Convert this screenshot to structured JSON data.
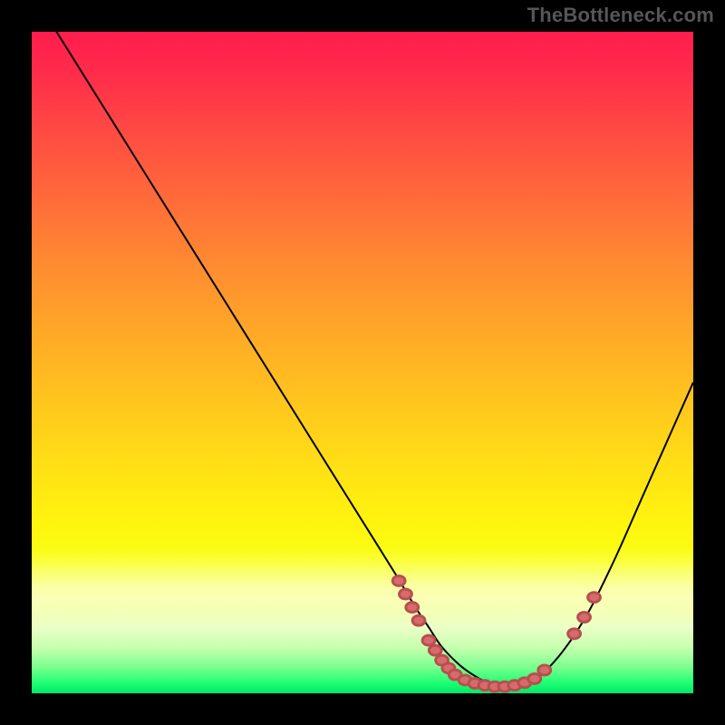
{
  "watermark": "TheBottleneck.com",
  "chart_data": {
    "type": "line",
    "title": "",
    "xlabel": "",
    "ylabel": "",
    "xlim": [
      0,
      100
    ],
    "ylim": [
      0,
      100
    ],
    "series": [
      {
        "name": "bottleneck-curve",
        "x": [
          0,
          5,
          10,
          15,
          20,
          25,
          30,
          35,
          40,
          45,
          50,
          55,
          58,
          60,
          62,
          65,
          68,
          70,
          73,
          76,
          80,
          84,
          88,
          92,
          96,
          100
        ],
        "y": [
          106,
          98,
          90,
          82,
          74,
          66,
          58,
          50,
          42,
          34,
          26,
          18,
          13,
          10,
          7,
          4,
          2,
          1,
          1,
          2,
          6,
          12,
          20,
          29,
          38,
          47
        ]
      }
    ],
    "markers": [
      {
        "x": 55.5,
        "y": 17
      },
      {
        "x": 56.5,
        "y": 15
      },
      {
        "x": 57.5,
        "y": 13
      },
      {
        "x": 58.5,
        "y": 11
      },
      {
        "x": 60,
        "y": 8
      },
      {
        "x": 61,
        "y": 6.5
      },
      {
        "x": 62,
        "y": 5
      },
      {
        "x": 63,
        "y": 3.8
      },
      {
        "x": 64,
        "y": 2.8
      },
      {
        "x": 65.5,
        "y": 2
      },
      {
        "x": 67,
        "y": 1.5
      },
      {
        "x": 68.5,
        "y": 1.2
      },
      {
        "x": 70,
        "y": 1
      },
      {
        "x": 71.5,
        "y": 1
      },
      {
        "x": 73,
        "y": 1.2
      },
      {
        "x": 74.5,
        "y": 1.6
      },
      {
        "x": 76,
        "y": 2.2
      },
      {
        "x": 77.5,
        "y": 3.5
      },
      {
        "x": 82,
        "y": 9
      },
      {
        "x": 83.5,
        "y": 11.5
      },
      {
        "x": 85,
        "y": 14.5
      }
    ],
    "gradient_stops": [
      {
        "pos": 0.0,
        "color": "#ff1d4d"
      },
      {
        "pos": 0.06,
        "color": "#ff2b4b"
      },
      {
        "pos": 0.15,
        "color": "#ff4a43"
      },
      {
        "pos": 0.25,
        "color": "#ff6a3a"
      },
      {
        "pos": 0.35,
        "color": "#ff8a31"
      },
      {
        "pos": 0.45,
        "color": "#ffa728"
      },
      {
        "pos": 0.55,
        "color": "#ffc31f"
      },
      {
        "pos": 0.65,
        "color": "#ffde16"
      },
      {
        "pos": 0.74,
        "color": "#fff40e"
      },
      {
        "pos": 0.8,
        "color": "#f9ff14"
      },
      {
        "pos": 0.86,
        "color": "#f2ff7a"
      },
      {
        "pos": 0.9,
        "color": "#e6ffc0"
      },
      {
        "pos": 0.93,
        "color": "#c9ffb0"
      },
      {
        "pos": 0.96,
        "color": "#7dff8f"
      },
      {
        "pos": 0.985,
        "color": "#1cff73"
      },
      {
        "pos": 1.0,
        "color": "#00e865"
      }
    ]
  }
}
